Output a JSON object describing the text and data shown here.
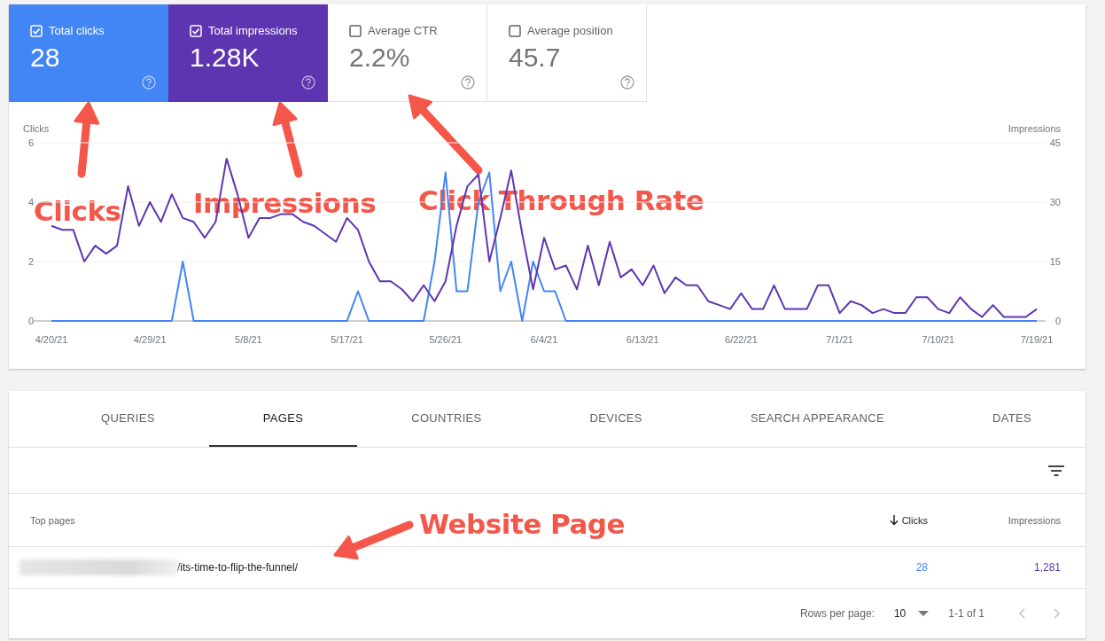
{
  "metrics": [
    {
      "label": "Total clicks",
      "value": "28",
      "checked": true,
      "color": "#4285f4"
    },
    {
      "label": "Total impressions",
      "value": "1.28K",
      "checked": true,
      "color": "#5e35b1"
    },
    {
      "label": "Average CTR",
      "value": "2.2%",
      "checked": false
    },
    {
      "label": "Average position",
      "value": "45.7",
      "checked": false
    }
  ],
  "performance_chart": {
    "chart_data": {
      "type": "line",
      "ylabel": "Clicks",
      "y2label": "Impressions",
      "ylim": [
        0,
        6
      ],
      "yticks": [
        0,
        2,
        4,
        6
      ],
      "y2lim": [
        0,
        45
      ],
      "y2ticks": [
        0,
        15,
        30,
        45
      ],
      "categories": [
        "4/20/21",
        null,
        null,
        null,
        null,
        null,
        null,
        null,
        null,
        "4/29/21",
        null,
        null,
        null,
        null,
        null,
        null,
        null,
        null,
        "5/8/21",
        null,
        null,
        null,
        null,
        null,
        null,
        null,
        null,
        "5/17/21",
        null,
        null,
        null,
        null,
        null,
        null,
        null,
        null,
        "5/26/21",
        null,
        null,
        null,
        null,
        null,
        null,
        null,
        null,
        "6/4/21",
        null,
        null,
        null,
        null,
        null,
        null,
        null,
        null,
        "6/13/21",
        null,
        null,
        null,
        null,
        null,
        null,
        null,
        null,
        "6/22/21",
        null,
        null,
        null,
        null,
        null,
        null,
        null,
        null,
        "7/1/21",
        null,
        null,
        null,
        null,
        null,
        null,
        null,
        null,
        "7/10/21",
        null,
        null,
        null,
        null,
        null,
        null,
        null,
        null,
        "7/19/21"
      ],
      "series": [
        {
          "color": "#4285f4",
          "values": [
            0,
            0,
            0,
            0,
            0,
            0,
            0,
            0,
            0,
            0,
            0,
            0,
            2,
            0,
            0,
            0,
            0,
            0,
            0,
            0,
            0,
            0,
            0,
            0,
            0,
            0,
            0,
            0,
            1,
            0,
            0,
            0,
            0,
            0,
            0,
            2,
            5,
            1,
            1,
            4,
            5,
            1,
            2,
            0,
            2,
            1,
            1,
            0,
            0,
            0,
            0,
            0,
            0,
            0,
            0,
            0,
            0,
            0,
            0,
            0,
            0,
            0,
            0,
            0,
            0,
            0,
            0,
            0,
            0,
            0,
            0,
            0,
            0,
            0,
            0,
            0,
            0,
            0,
            0,
            0,
            0,
            0,
            0,
            0,
            0,
            0,
            0,
            0,
            0,
            0,
            0
          ]
        },
        {
          "color": "#5e35b1",
          "axis": "y2",
          "values": [
            24,
            23,
            23,
            15,
            19,
            17,
            19,
            34,
            24,
            30,
            25,
            32,
            26,
            25,
            21,
            25,
            41,
            32,
            21,
            26,
            26,
            27,
            27,
            25,
            24,
            22,
            20,
            26,
            23,
            15,
            10,
            10,
            8,
            5,
            9,
            5,
            10,
            24,
            34,
            37,
            15,
            26,
            38,
            22,
            8,
            21,
            13,
            14,
            8,
            19,
            9,
            20,
            11,
            13,
            9,
            14,
            7,
            11,
            9,
            9,
            5,
            4,
            3,
            7,
            3,
            3,
            9,
            3,
            3,
            3,
            9,
            9,
            2,
            5,
            4,
            2,
            3,
            2,
            2,
            6,
            6,
            3,
            2,
            6,
            3,
            1,
            4,
            1,
            1,
            1,
            3
          ]
        }
      ]
    }
  },
  "tabs": [
    {
      "label": "QUERIES",
      "selected": false
    },
    {
      "label": "PAGES",
      "selected": true
    },
    {
      "label": "COUNTRIES",
      "selected": false
    },
    {
      "label": "DEVICES",
      "selected": false
    },
    {
      "label": "SEARCH APPEARANCE",
      "selected": false
    },
    {
      "label": "DATES",
      "selected": false
    }
  ],
  "table": {
    "columns": [
      {
        "label": "Top pages",
        "sorted": false
      },
      {
        "label": "Clicks",
        "sorted": true
      },
      {
        "label": "Impressions",
        "sorted": false
      }
    ],
    "rows": [
      {
        "page": "/its-time-to-flip-the-funnel/",
        "clicks": "28",
        "impressions": "1,281"
      }
    ]
  },
  "pagination": {
    "rows_label": "Rows per page:",
    "rows_value": "10",
    "range": "1-1 of 1",
    "buttons": [
      {
        "kind": "previous",
        "disabled": true
      },
      {
        "kind": "next",
        "disabled": true
      }
    ]
  },
  "annotations": [
    {
      "text": "Clicks"
    },
    {
      "text": "Impressions"
    },
    {
      "text": "Click Through Rate"
    },
    {
      "text": "Website Page"
    }
  ]
}
